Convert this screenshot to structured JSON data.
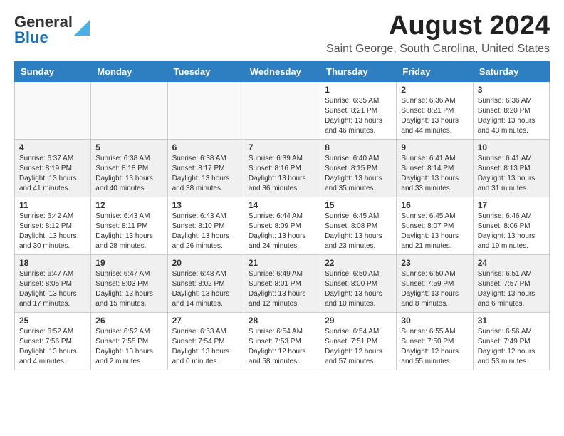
{
  "header": {
    "logo_line1": "General",
    "logo_line2": "Blue",
    "month_title": "August 2024",
    "location": "Saint George, South Carolina, United States"
  },
  "days_of_week": [
    "Sunday",
    "Monday",
    "Tuesday",
    "Wednesday",
    "Thursday",
    "Friday",
    "Saturday"
  ],
  "weeks": [
    [
      {
        "day": "",
        "sunrise": "",
        "sunset": "",
        "daylight": "",
        "empty": true
      },
      {
        "day": "",
        "sunrise": "",
        "sunset": "",
        "daylight": "",
        "empty": true
      },
      {
        "day": "",
        "sunrise": "",
        "sunset": "",
        "daylight": "",
        "empty": true
      },
      {
        "day": "",
        "sunrise": "",
        "sunset": "",
        "daylight": "",
        "empty": true
      },
      {
        "day": "1",
        "sunrise": "Sunrise: 6:35 AM",
        "sunset": "Sunset: 8:21 PM",
        "daylight": "Daylight: 13 hours and 46 minutes.",
        "empty": false
      },
      {
        "day": "2",
        "sunrise": "Sunrise: 6:36 AM",
        "sunset": "Sunset: 8:21 PM",
        "daylight": "Daylight: 13 hours and 44 minutes.",
        "empty": false
      },
      {
        "day": "3",
        "sunrise": "Sunrise: 6:36 AM",
        "sunset": "Sunset: 8:20 PM",
        "daylight": "Daylight: 13 hours and 43 minutes.",
        "empty": false
      }
    ],
    [
      {
        "day": "4",
        "sunrise": "Sunrise: 6:37 AM",
        "sunset": "Sunset: 8:19 PM",
        "daylight": "Daylight: 13 hours and 41 minutes.",
        "empty": false
      },
      {
        "day": "5",
        "sunrise": "Sunrise: 6:38 AM",
        "sunset": "Sunset: 8:18 PM",
        "daylight": "Daylight: 13 hours and 40 minutes.",
        "empty": false
      },
      {
        "day": "6",
        "sunrise": "Sunrise: 6:38 AM",
        "sunset": "Sunset: 8:17 PM",
        "daylight": "Daylight: 13 hours and 38 minutes.",
        "empty": false
      },
      {
        "day": "7",
        "sunrise": "Sunrise: 6:39 AM",
        "sunset": "Sunset: 8:16 PM",
        "daylight": "Daylight: 13 hours and 36 minutes.",
        "empty": false
      },
      {
        "day": "8",
        "sunrise": "Sunrise: 6:40 AM",
        "sunset": "Sunset: 8:15 PM",
        "daylight": "Daylight: 13 hours and 35 minutes.",
        "empty": false
      },
      {
        "day": "9",
        "sunrise": "Sunrise: 6:41 AM",
        "sunset": "Sunset: 8:14 PM",
        "daylight": "Daylight: 13 hours and 33 minutes.",
        "empty": false
      },
      {
        "day": "10",
        "sunrise": "Sunrise: 6:41 AM",
        "sunset": "Sunset: 8:13 PM",
        "daylight": "Daylight: 13 hours and 31 minutes.",
        "empty": false
      }
    ],
    [
      {
        "day": "11",
        "sunrise": "Sunrise: 6:42 AM",
        "sunset": "Sunset: 8:12 PM",
        "daylight": "Daylight: 13 hours and 30 minutes.",
        "empty": false
      },
      {
        "day": "12",
        "sunrise": "Sunrise: 6:43 AM",
        "sunset": "Sunset: 8:11 PM",
        "daylight": "Daylight: 13 hours and 28 minutes.",
        "empty": false
      },
      {
        "day": "13",
        "sunrise": "Sunrise: 6:43 AM",
        "sunset": "Sunset: 8:10 PM",
        "daylight": "Daylight: 13 hours and 26 minutes.",
        "empty": false
      },
      {
        "day": "14",
        "sunrise": "Sunrise: 6:44 AM",
        "sunset": "Sunset: 8:09 PM",
        "daylight": "Daylight: 13 hours and 24 minutes.",
        "empty": false
      },
      {
        "day": "15",
        "sunrise": "Sunrise: 6:45 AM",
        "sunset": "Sunset: 8:08 PM",
        "daylight": "Daylight: 13 hours and 23 minutes.",
        "empty": false
      },
      {
        "day": "16",
        "sunrise": "Sunrise: 6:45 AM",
        "sunset": "Sunset: 8:07 PM",
        "daylight": "Daylight: 13 hours and 21 minutes.",
        "empty": false
      },
      {
        "day": "17",
        "sunrise": "Sunrise: 6:46 AM",
        "sunset": "Sunset: 8:06 PM",
        "daylight": "Daylight: 13 hours and 19 minutes.",
        "empty": false
      }
    ],
    [
      {
        "day": "18",
        "sunrise": "Sunrise: 6:47 AM",
        "sunset": "Sunset: 8:05 PM",
        "daylight": "Daylight: 13 hours and 17 minutes.",
        "empty": false
      },
      {
        "day": "19",
        "sunrise": "Sunrise: 6:47 AM",
        "sunset": "Sunset: 8:03 PM",
        "daylight": "Daylight: 13 hours and 15 minutes.",
        "empty": false
      },
      {
        "day": "20",
        "sunrise": "Sunrise: 6:48 AM",
        "sunset": "Sunset: 8:02 PM",
        "daylight": "Daylight: 13 hours and 14 minutes.",
        "empty": false
      },
      {
        "day": "21",
        "sunrise": "Sunrise: 6:49 AM",
        "sunset": "Sunset: 8:01 PM",
        "daylight": "Daylight: 13 hours and 12 minutes.",
        "empty": false
      },
      {
        "day": "22",
        "sunrise": "Sunrise: 6:50 AM",
        "sunset": "Sunset: 8:00 PM",
        "daylight": "Daylight: 13 hours and 10 minutes.",
        "empty": false
      },
      {
        "day": "23",
        "sunrise": "Sunrise: 6:50 AM",
        "sunset": "Sunset: 7:59 PM",
        "daylight": "Daylight: 13 hours and 8 minutes.",
        "empty": false
      },
      {
        "day": "24",
        "sunrise": "Sunrise: 6:51 AM",
        "sunset": "Sunset: 7:57 PM",
        "daylight": "Daylight: 13 hours and 6 minutes.",
        "empty": false
      }
    ],
    [
      {
        "day": "25",
        "sunrise": "Sunrise: 6:52 AM",
        "sunset": "Sunset: 7:56 PM",
        "daylight": "Daylight: 13 hours and 4 minutes.",
        "empty": false
      },
      {
        "day": "26",
        "sunrise": "Sunrise: 6:52 AM",
        "sunset": "Sunset: 7:55 PM",
        "daylight": "Daylight: 13 hours and 2 minutes.",
        "empty": false
      },
      {
        "day": "27",
        "sunrise": "Sunrise: 6:53 AM",
        "sunset": "Sunset: 7:54 PM",
        "daylight": "Daylight: 13 hours and 0 minutes.",
        "empty": false
      },
      {
        "day": "28",
        "sunrise": "Sunrise: 6:54 AM",
        "sunset": "Sunset: 7:53 PM",
        "daylight": "Daylight: 12 hours and 58 minutes.",
        "empty": false
      },
      {
        "day": "29",
        "sunrise": "Sunrise: 6:54 AM",
        "sunset": "Sunset: 7:51 PM",
        "daylight": "Daylight: 12 hours and 57 minutes.",
        "empty": false
      },
      {
        "day": "30",
        "sunrise": "Sunrise: 6:55 AM",
        "sunset": "Sunset: 7:50 PM",
        "daylight": "Daylight: 12 hours and 55 minutes.",
        "empty": false
      },
      {
        "day": "31",
        "sunrise": "Sunrise: 6:56 AM",
        "sunset": "Sunset: 7:49 PM",
        "daylight": "Daylight: 12 hours and 53 minutes.",
        "empty": false
      }
    ]
  ]
}
